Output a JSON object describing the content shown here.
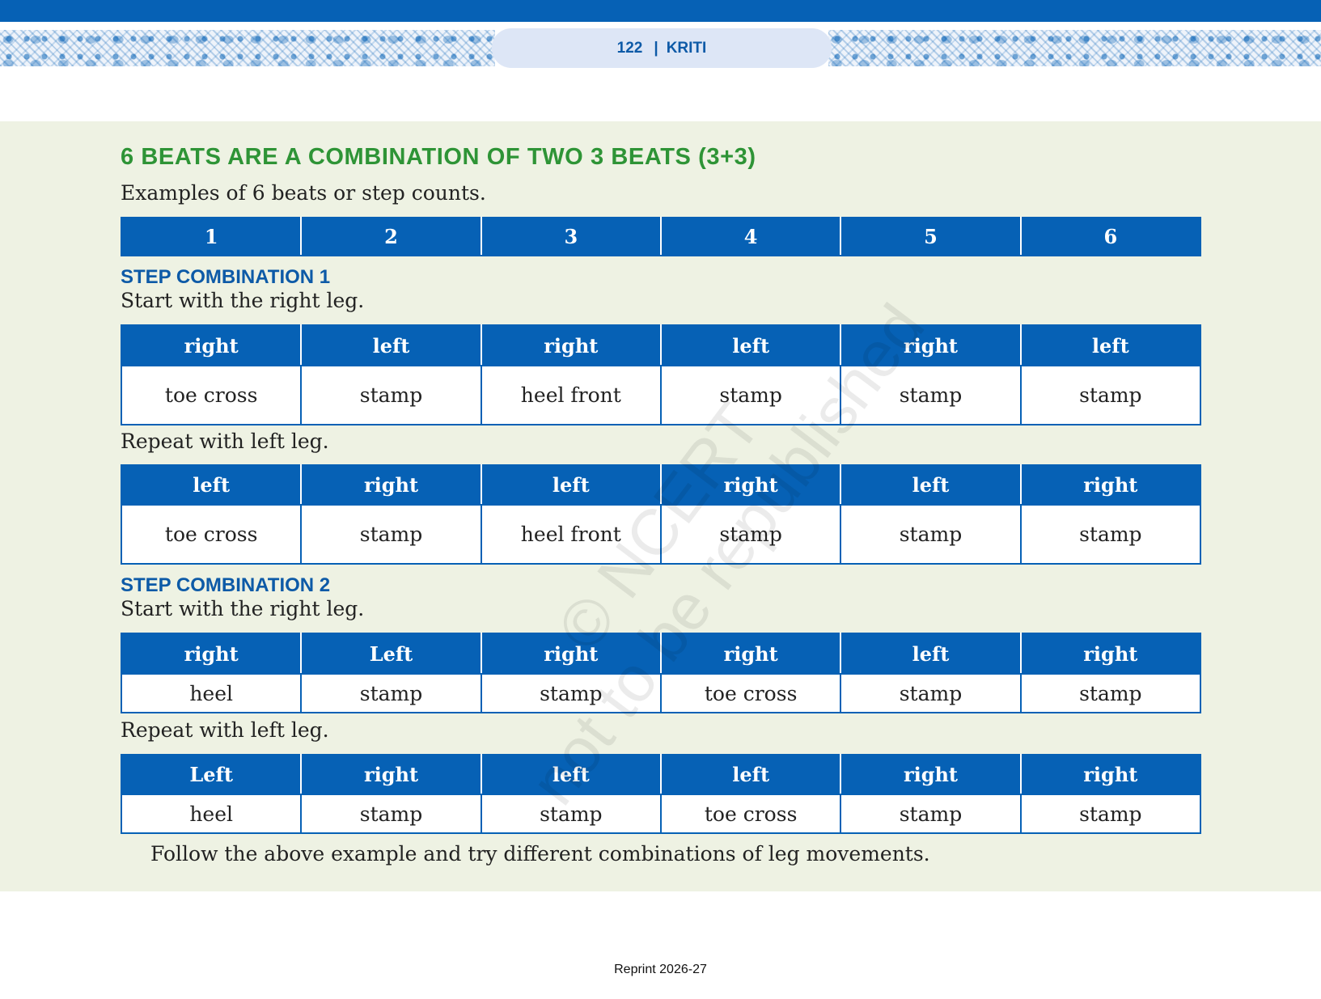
{
  "header": {
    "page_number": "122",
    "separator": "|",
    "book": "KRITI"
  },
  "section": {
    "heading": "6 BEATS ARE A COMBINATION OF TWO 3 BEATS (3+3)",
    "intro": "Examples of 6 beats or step counts."
  },
  "count_row": [
    "1",
    "2",
    "3",
    "4",
    "5",
    "6"
  ],
  "combo1": {
    "title": "STEP COMBINATION 1",
    "start_text": "Start with the right leg.",
    "table_a": {
      "legs": [
        "right",
        "left",
        "right",
        "left",
        "right",
        "left"
      ],
      "moves": [
        "toe cross",
        "stamp",
        "heel front",
        "stamp",
        "stamp",
        "stamp"
      ]
    },
    "repeat_text": "Repeat with left leg.",
    "table_b": {
      "legs": [
        "left",
        "right",
        "left",
        "right",
        "left",
        "right"
      ],
      "moves": [
        "toe cross",
        "stamp",
        "heel front",
        "stamp",
        "stamp",
        "stamp"
      ]
    }
  },
  "combo2": {
    "title": "STEP COMBINATION 2",
    "start_text": "Start with the right leg.",
    "table_a": {
      "legs": [
        "right",
        "Left",
        "right",
        "right",
        "left",
        "right"
      ],
      "moves": [
        "heel",
        "stamp",
        "stamp",
        "toe cross",
        "stamp",
        "stamp"
      ]
    },
    "repeat_text": "Repeat with left leg.",
    "table_b": {
      "legs": [
        "Left",
        "right",
        "left",
        "left",
        "right",
        "right"
      ],
      "moves": [
        "heel",
        "stamp",
        "stamp",
        "toe cross",
        "stamp",
        "stamp"
      ]
    }
  },
  "closing": "Follow the above example and try different combinations of leg movements.",
  "watermark": {
    "line1": "© NCERT",
    "line2": "not to be republished"
  },
  "footer": "Reprint 2026-27"
}
